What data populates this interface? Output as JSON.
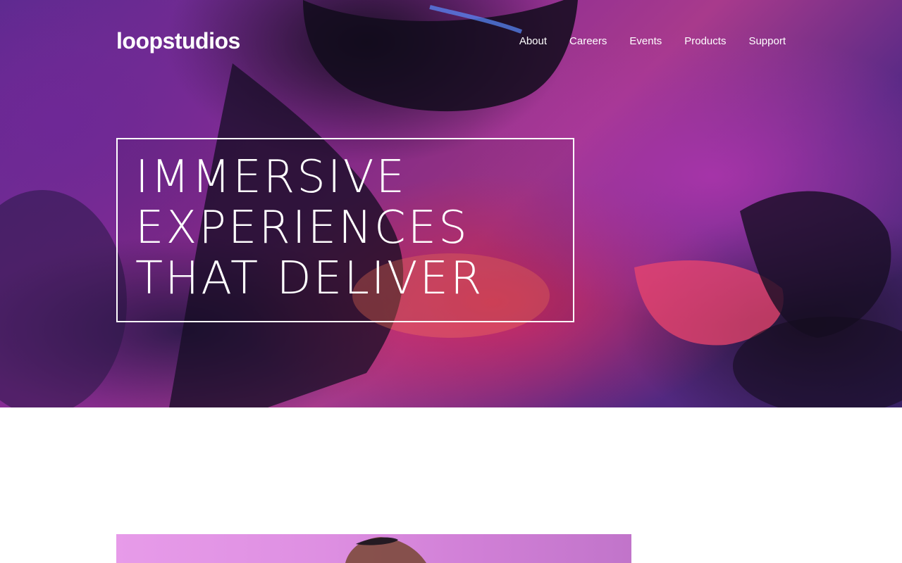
{
  "brand": {
    "logo_text": "loopstudios"
  },
  "nav": {
    "items": [
      {
        "label": "About"
      },
      {
        "label": "Careers"
      },
      {
        "label": "Events"
      },
      {
        "label": "Products"
      },
      {
        "label": "Support"
      }
    ]
  },
  "hero": {
    "headline_lines": [
      "IMMERSIVE",
      "EXPERIENCES",
      "THAT DELIVER"
    ],
    "image_subject": "person wearing VR headset under neon lights"
  },
  "feature": {
    "image_subject": "person with VR headset on pink background"
  },
  "colors": {
    "text": "#ffffff",
    "border": "#ffffff",
    "hero_magenta": "#a83a8c",
    "hero_purple": "#5b2a8f",
    "feature_pink": "#e79be9"
  }
}
